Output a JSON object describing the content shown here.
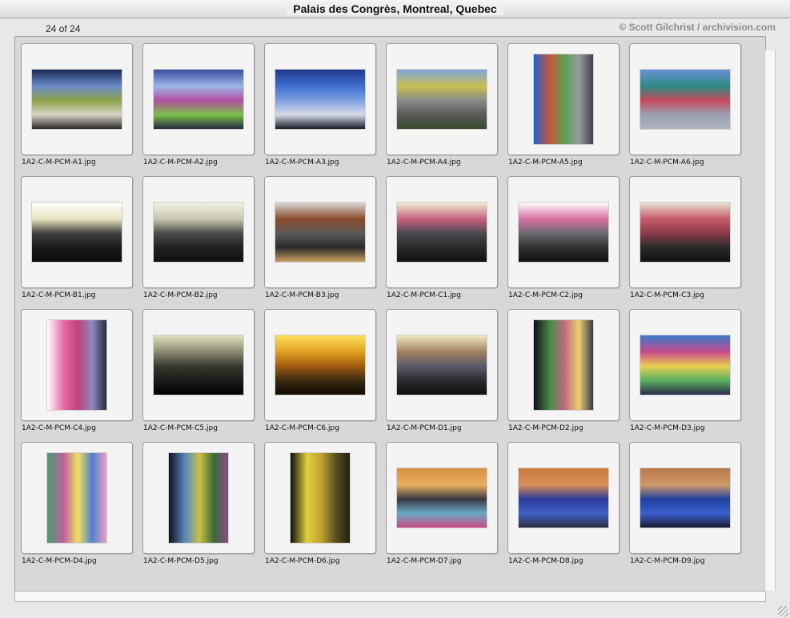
{
  "window": {
    "title": "Palais des Congrès, Montreal, Quebec"
  },
  "header": {
    "count": "24 of 24",
    "credit": "© Scott Gilchrist / archivision.com"
  },
  "thumbnails": [
    {
      "filename": "1A2-C-M-PCM-A1.jpg",
      "orientation": "landscape",
      "colors": [
        "#1c2a55",
        "#6a8ac8",
        "#8ea34a",
        "#d9d4c8",
        "#2a2a2a"
      ]
    },
    {
      "filename": "1A2-C-M-PCM-A2.jpg",
      "orientation": "landscape",
      "colors": [
        "#3a4ea0",
        "#9fb5e8",
        "#b04fa0",
        "#7cc04a",
        "#252a40"
      ]
    },
    {
      "filename": "1A2-C-M-PCM-A3.jpg",
      "orientation": "landscape",
      "colors": [
        "#1d3a8a",
        "#3f6ed0",
        "#7ea0e0",
        "#d8dce8",
        "#1a1a2a"
      ]
    },
    {
      "filename": "1A2-C-M-PCM-A4.jpg",
      "orientation": "landscape",
      "colors": [
        "#7fa6dc",
        "#c8c050",
        "#8a8a8a",
        "#5a5a5a",
        "#3a4a2a"
      ]
    },
    {
      "filename": "1A2-C-M-PCM-A5.jpg",
      "orientation": "portrait",
      "colors": [
        "#2a5ac8",
        "#c85a3a",
        "#5aa050",
        "#9a9aa0",
        "#404050"
      ]
    },
    {
      "filename": "1A2-C-M-PCM-A6.jpg",
      "orientation": "landscape",
      "colors": [
        "#6a90d8",
        "#2a8a80",
        "#c84a60",
        "#9aa0b0",
        "#b0b4c0"
      ]
    },
    {
      "filename": "1A2-C-M-PCM-B1.jpg",
      "orientation": "landscape",
      "colors": [
        "#ffffff",
        "#e8e4c0",
        "#404040",
        "#1a1a1a",
        "#0a0a0a"
      ]
    },
    {
      "filename": "1A2-C-M-PCM-B2.jpg",
      "orientation": "landscape",
      "colors": [
        "#f0f0e0",
        "#c8c8b0",
        "#4a4a4a",
        "#202020",
        "#101010"
      ]
    },
    {
      "filename": "1A2-C-M-PCM-B3.jpg",
      "orientation": "landscape",
      "colors": [
        "#d8d8d8",
        "#8a4a2a",
        "#5a5a5a",
        "#2a2a2a",
        "#c8a060"
      ]
    },
    {
      "filename": "1A2-C-M-PCM-C1.jpg",
      "orientation": "landscape",
      "colors": [
        "#f0ecd0",
        "#c86080",
        "#4a4a50",
        "#2a2a2a",
        "#101010"
      ]
    },
    {
      "filename": "1A2-C-M-PCM-C2.jpg",
      "orientation": "landscape",
      "colors": [
        "#ffffff",
        "#d870a0",
        "#6a6a70",
        "#303030",
        "#101010"
      ]
    },
    {
      "filename": "1A2-C-M-PCM-C3.jpg",
      "orientation": "landscape",
      "colors": [
        "#e8e0d0",
        "#c85a6a",
        "#8a3a4a",
        "#2a2a2a",
        "#101010"
      ]
    },
    {
      "filename": "1A2-C-M-PCM-C4.jpg",
      "orientation": "portrait",
      "colors": [
        "#ffffff",
        "#e86aa0",
        "#c04080",
        "#8a8ac0",
        "#2a2a3a"
      ]
    },
    {
      "filename": "1A2-C-M-PCM-C5.jpg",
      "orientation": "landscape",
      "colors": [
        "#e0e0c0",
        "#8a8a70",
        "#3a3a30",
        "#1a1a1a",
        "#000000"
      ]
    },
    {
      "filename": "1A2-C-M-PCM-C6.jpg",
      "orientation": "landscape",
      "colors": [
        "#ffe060",
        "#e0a020",
        "#a05a10",
        "#3a2a10",
        "#100800"
      ]
    },
    {
      "filename": "1A2-C-M-PCM-D1.jpg",
      "orientation": "landscape",
      "colors": [
        "#f0e8c0",
        "#a08060",
        "#5a5a6a",
        "#2a2a30",
        "#101010"
      ]
    },
    {
      "filename": "1A2-C-M-PCM-D2.jpg",
      "orientation": "portrait",
      "colors": [
        "#101018",
        "#4a8a4a",
        "#c06a80",
        "#e8d070",
        "#3a3a4a"
      ]
    },
    {
      "filename": "1A2-C-M-PCM-D3.jpg",
      "orientation": "landscape",
      "colors": [
        "#3a7ac8",
        "#c84a8a",
        "#e8d050",
        "#5ab060",
        "#2a2a4a"
      ]
    },
    {
      "filename": "1A2-C-M-PCM-D4.jpg",
      "orientation": "portrait",
      "colors": [
        "#40a070",
        "#c060a0",
        "#f0e060",
        "#5080d0",
        "#f0a0c0"
      ]
    },
    {
      "filename": "1A2-C-M-PCM-D5.jpg",
      "orientation": "portrait",
      "colors": [
        "#101020",
        "#5a8ac0",
        "#c8c040",
        "#3a6a3a",
        "#8a4a8a"
      ]
    },
    {
      "filename": "1A2-C-M-PCM-D6.jpg",
      "orientation": "portrait",
      "colors": [
        "#101008",
        "#e0d040",
        "#c0a030",
        "#5a5020",
        "#202010"
      ]
    },
    {
      "filename": "1A2-C-M-PCM-D7.jpg",
      "orientation": "landscape",
      "colors": [
        "#d89040",
        "#e8b060",
        "#3a3a40",
        "#6aa8c8",
        "#c84a80"
      ]
    },
    {
      "filename": "1A2-C-M-PCM-D8.jpg",
      "orientation": "landscape",
      "colors": [
        "#c87a3a",
        "#d8905a",
        "#2a3a9a",
        "#4060c8",
        "#2a2a40"
      ]
    },
    {
      "filename": "1A2-C-M-PCM-D9.jpg",
      "orientation": "landscape",
      "colors": [
        "#b87a4a",
        "#d09a6a",
        "#2040a0",
        "#3a60d0",
        "#1a1a30"
      ]
    }
  ]
}
